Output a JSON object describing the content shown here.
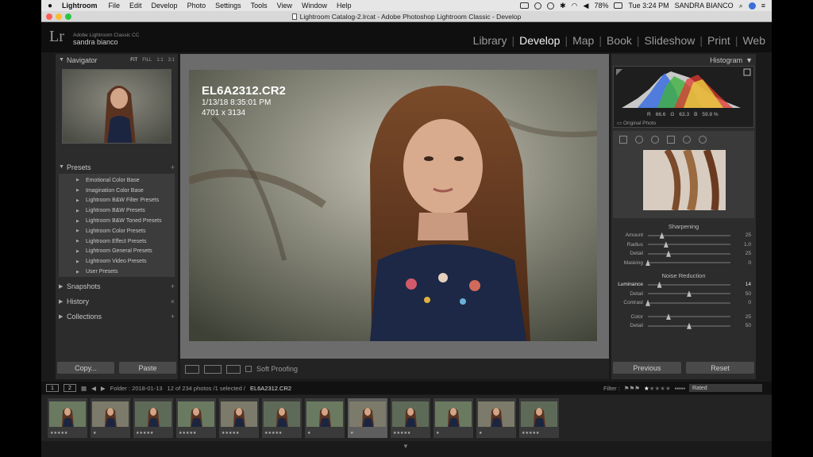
{
  "menubar": {
    "apple": "",
    "app_name": "Lightroom",
    "items": [
      "File",
      "Edit",
      "Develop",
      "Photo",
      "Settings",
      "Tools",
      "View",
      "Window",
      "Help"
    ],
    "battery": "78%",
    "clock": "Tue 3:24 PM",
    "user": "SANDRA BIANCO"
  },
  "window": {
    "title": "Lightroom Catalog-2.lrcat - Adobe Photoshop Lightroom Classic - Develop"
  },
  "header": {
    "logo": "Lr",
    "product": "Adobe Lightroom Classic CC",
    "user": "sandra bianco",
    "modules": [
      "Library",
      "Develop",
      "Map",
      "Book",
      "Slideshow",
      "Print",
      "Web"
    ],
    "active_module": "Develop"
  },
  "left_panel": {
    "navigator": {
      "title": "Navigator",
      "zoom": [
        "FIT",
        "FILL",
        "1:1",
        "3:1"
      ]
    },
    "presets": {
      "title": "Presets",
      "items": [
        "Emotional Color Base",
        "Imagination Color Base",
        "Lightroom B&W Filter Presets",
        "Lightroom B&W Presets",
        "Lightroom B&W Toned Presets",
        "Lightroom Color Presets",
        "Lightroom Effect Presets",
        "Lightroom General Presets",
        "Lightroom Video Presets",
        "User Presets"
      ]
    },
    "snapshots": "Snapshots",
    "history": "History",
    "collections": "Collections",
    "copy_button": "Copy...",
    "paste_button": "Paste"
  },
  "photo_info": {
    "filename": "EL6A2312.CR2",
    "datetime": "1/13/18 8:35:01 PM",
    "dimensions": "4701 x 3134"
  },
  "toolbar": {
    "soft_proofing": "Soft Proofing"
  },
  "right_panel": {
    "histogram_title": "Histogram",
    "readout": {
      "r_label": "R",
      "r": "66.6",
      "g_label": "G",
      "g": "63.3",
      "b_label": "B",
      "b": "59.8 %"
    },
    "original_photo": "Original Photo",
    "sharpening": {
      "title": "Sharpening",
      "sliders": [
        {
          "label": "Amount",
          "value": "25",
          "level": 0.17
        },
        {
          "label": "Radius",
          "value": "1.0",
          "level": 0.22
        },
        {
          "label": "Detail",
          "value": "25",
          "level": 0.25
        },
        {
          "label": "Masking",
          "value": "0",
          "level": 0.0
        }
      ]
    },
    "noise_reduction": {
      "title": "Noise Reduction",
      "sliders": [
        {
          "label": "Luminance",
          "value": "14",
          "level": 0.14,
          "bright": true
        },
        {
          "label": "Detail",
          "value": "50",
          "level": 0.5
        },
        {
          "label": "Contrast",
          "value": "0",
          "level": 0.0
        },
        {
          "label": "Color",
          "value": "25",
          "level": 0.25
        },
        {
          "label": "Detail",
          "value": "50",
          "level": 0.5
        }
      ]
    },
    "previous_button": "Previous",
    "reset_button": "Reset"
  },
  "filmstrip_bar": {
    "page1": "1",
    "page2": "2",
    "folder": "Folder : 2018-01-13",
    "count": "12 of 234 photos /1 selected /",
    "selected_file": "EL6A2312.CR2",
    "filter_label": "Filter :",
    "filter_value": "Rated",
    "filter_rating": 1
  },
  "filmstrip": {
    "thumbnails": [
      {
        "stars": "★★★★★",
        "selected": false
      },
      {
        "stars": "★",
        "selected": false
      },
      {
        "stars": "★★★★★",
        "selected": false
      },
      {
        "stars": "★★★★★",
        "selected": false
      },
      {
        "stars": "★★★★★",
        "selected": false
      },
      {
        "stars": "★★★★★",
        "selected": false
      },
      {
        "stars": "★",
        "selected": false
      },
      {
        "stars": "★",
        "selected": true
      },
      {
        "stars": "★★★★★",
        "selected": false
      },
      {
        "stars": "★",
        "selected": false
      },
      {
        "stars": "★",
        "selected": false
      },
      {
        "stars": "★★★★★",
        "selected": false
      }
    ]
  },
  "colors": {
    "accent_active": "#f0f0f0",
    "panel_bg": "#2c2c2c",
    "canvas_bg": "#6c6c6c"
  }
}
